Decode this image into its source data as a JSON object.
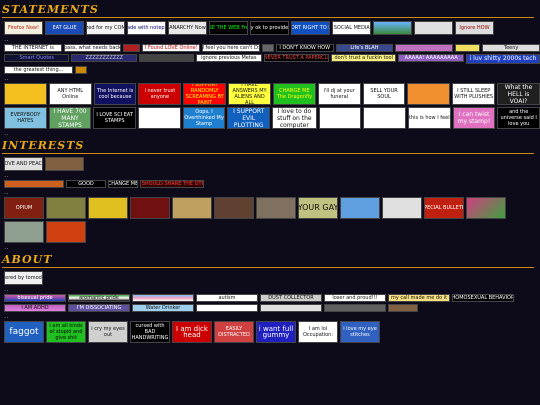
{
  "sections": {
    "statements": "Statements",
    "interests": "Interests",
    "about": "About"
  },
  "rows": {
    "r1": [
      "Firefox Now!",
      "EAT GLUE",
      "Optimized for my COMPUTER",
      "made with notepad",
      "ANARCHY Now",
      "USE THE WEB Free",
      "it's naturally ok to provide your HTML",
      "I SUPPORT RIGHT TO REPAIR",
      "STOP SOCIAL MEDIA NOW",
      "",
      "",
      "Ignore HOW"
    ],
    "r2": [
      "THE INTERNET is",
      "bypass, what needs backup",
      "",
      "I Found LOVE Online!",
      "I feel you here can't D:",
      "",
      "I DON'T KNOW HOW",
      "Life's BLAH",
      "",
      "",
      "Teeny"
    ],
    "r3": [
      "Smart Quotes",
      "ZZZZZZZZZZZ",
      "",
      "ignore previous  Metas",
      "I NEVER TRUST A PAPERCLIP",
      "don't trust a fuckin tool",
      "AAAAA!  AAAAAAAAA",
      "i luv shitty 2000s tech"
    ],
    "r4": [
      "the greatest thing...",
      ""
    ],
    "r5": [
      "",
      "ANY HTML Online",
      "The Internet is cool because",
      "i never trust anyone",
      "I SUPPORT RANDOMLY SCREAMING BY PAINT",
      "I HAVE ANSWERS MY ALIENS AND ALL",
      "CHANGE ME The Dragonfly",
      "i'll dj at your funeral",
      "SELL YOUR SOUL",
      "",
      "I STILL SLEEP WITH PLUSHIES",
      "What the HELL is VOAI?"
    ],
    "r6": [
      "EVERYBODY HATES",
      "I HAVE 700 MANY STAMPS",
      "I LOVE SCI EAT STAMPS",
      "",
      "Oops, I Overthinked My Stamp",
      "I SUPPORT EVIL PLOTTING",
      "I love to do stuff on the computer",
      "",
      "",
      "this is how I feel",
      "I can twist my stamp!",
      "and the universe said I love you"
    ],
    "r7": [
      "LOVE AND PEACE",
      "",
      ""
    ],
    "r8": [
      "",
      "GOOD",
      "CHANGE ME",
      "WE SHOULD SHARE THE OTHER"
    ],
    "r9": [
      "OPIUM",
      "",
      "",
      "",
      "",
      "",
      "",
      "YOUR GAY",
      "",
      "",
      "SPECIAL BULLETIN",
      ""
    ],
    "r10": [
      "",
      ""
    ],
    "r11": [
      "powered by tomodachi"
    ],
    "r12": [
      "bisexual pride",
      "aromantic pride",
      "",
      "autism",
      "DUST COLLECTOR",
      "loser and proud!!!",
      "my call made me do it",
      "HOMOSEXUAL BEHAVIOR"
    ],
    "r13": [
      "I AM ADHD",
      "I'M DISSOCIATING",
      "Water Drinker",
      "",
      "",
      "",
      ""
    ],
    "r14": [
      "faggot",
      "i am all kinds of stupid and give shit",
      "i cry my eyes out",
      "cursed with BAD HANDWRITING",
      "I am dick head",
      "EASILY DISTRACTED",
      "i want full gummy",
      "I am lol Occupation:",
      "i love my eye stitches"
    ]
  },
  "colors": {
    "accent": "#e8a818",
    "background": "#0d0b1a"
  }
}
